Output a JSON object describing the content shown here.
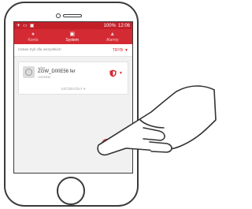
{
  "statusbar": {
    "left_icons": [
      "✈",
      "▭",
      "▣"
    ],
    "battery": "100%",
    "time": "12:06"
  },
  "topnav": {
    "tabs": [
      {
        "label": "Konto",
        "icon": "user-icon"
      },
      {
        "label": "System",
        "icon": "system-icon"
      },
      {
        "label": "Alarmy",
        "icon": "bell-icon"
      }
    ],
    "active_tab": "System"
  },
  "mode_row": {
    "label": "Ustaw tryb dla wszystkich",
    "value": "TRYB"
  },
  "device_card": {
    "status": "online",
    "name": "ZGW_D00E56 fer",
    "id": "10025E56",
    "details_label": "SZCZEGÓŁY"
  },
  "fab": {
    "label": "+"
  },
  "colors": {
    "accent": "#d42a33",
    "statusbar": "#c4202a",
    "background": "#f1f1f1"
  }
}
